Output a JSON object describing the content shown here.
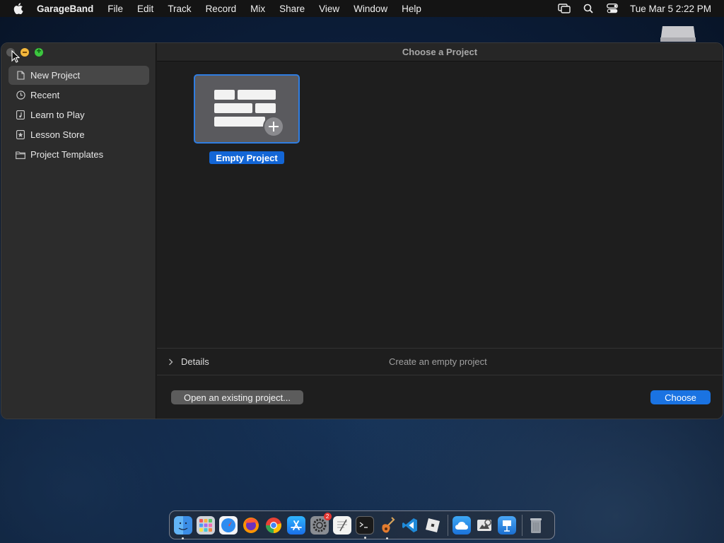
{
  "menubar": {
    "app_name": "GarageBand",
    "items": [
      "File",
      "Edit",
      "Track",
      "Record",
      "Mix",
      "Share",
      "View",
      "Window",
      "Help"
    ],
    "clock": "Tue Mar 5  2:22 PM",
    "status_icons": [
      "screen-mirroring-icon",
      "spotlight-search-icon",
      "control-center-icon"
    ]
  },
  "sidebar": {
    "items": [
      {
        "label": "New Project",
        "icon": "document-icon",
        "selected": true
      },
      {
        "label": "Recent",
        "icon": "clock-icon"
      },
      {
        "label": "Learn to Play",
        "icon": "music-note-icon"
      },
      {
        "label": "Lesson Store",
        "icon": "star-icon"
      },
      {
        "label": "Project Templates",
        "icon": "folder-icon"
      }
    ]
  },
  "main": {
    "title": "Choose a Project",
    "tile_label": "Empty Project",
    "details_label": "Details",
    "details_description": "Create an empty project",
    "open_button": "Open an existing project...",
    "choose_button": "Choose"
  },
  "dock": {
    "apps": [
      "finder",
      "launchpad",
      "safari",
      "firefox",
      "chrome",
      "app-store",
      "system-settings",
      "textedit",
      "terminal",
      "garageband",
      "vscode",
      "roblox",
      "icloud-drive",
      "preview",
      "keynote",
      "trash"
    ],
    "system_settings_badge": "2"
  },
  "colors": {
    "accent": "#1a73e2",
    "selection_border": "#2f7de1",
    "sidebar_bg": "#2c2c2c",
    "window_bg": "#1e1e1e"
  }
}
